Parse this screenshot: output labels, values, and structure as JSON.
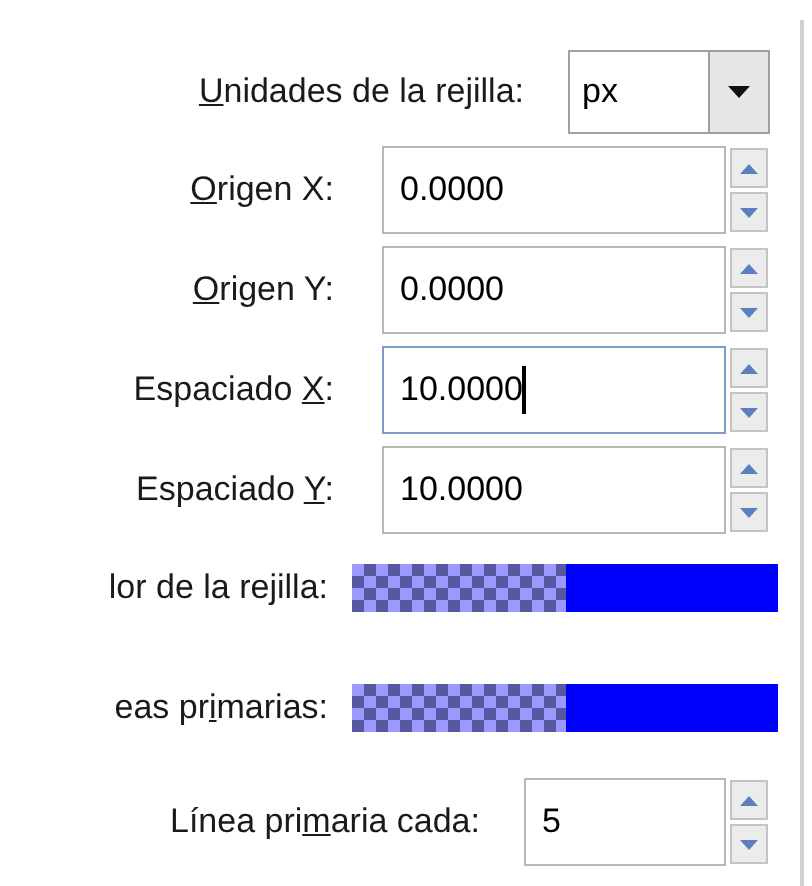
{
  "rows": [
    {
      "kind": "combo",
      "label": {
        "key": "U",
        "post": "nidades de la rejilla:"
      },
      "value": "px"
    },
    {
      "kind": "spin",
      "label": {
        "key": "O",
        "post": "rigen X:"
      },
      "value": "0.0000",
      "focused": false
    },
    {
      "kind": "spin",
      "label": {
        "key": "O",
        "post": "rigen Y:"
      },
      "value": "0.0000",
      "focused": false
    },
    {
      "kind": "spin",
      "label": {
        "pre": "Espaciado ",
        "key": "X",
        "post": ":"
      },
      "value": "10.0000",
      "focused": true
    },
    {
      "kind": "spin",
      "label": {
        "pre": "Espaciado ",
        "key": "Y",
        "post": ":"
      },
      "value": "10.0000",
      "focused": false
    },
    {
      "kind": "color",
      "label": {
        "pre": "lor de la rejilla:"
      },
      "color": "#0000ff"
    },
    {
      "kind": "color",
      "label": {
        "pre": "eas pr",
        "key": "i",
        "post": "marias:"
      },
      "color": "#0000ff"
    },
    {
      "kind": "spin",
      "label": {
        "pre": "Línea pri",
        "key": "m",
        "post": "aria cada:"
      },
      "value": "5",
      "focused": false
    }
  ]
}
